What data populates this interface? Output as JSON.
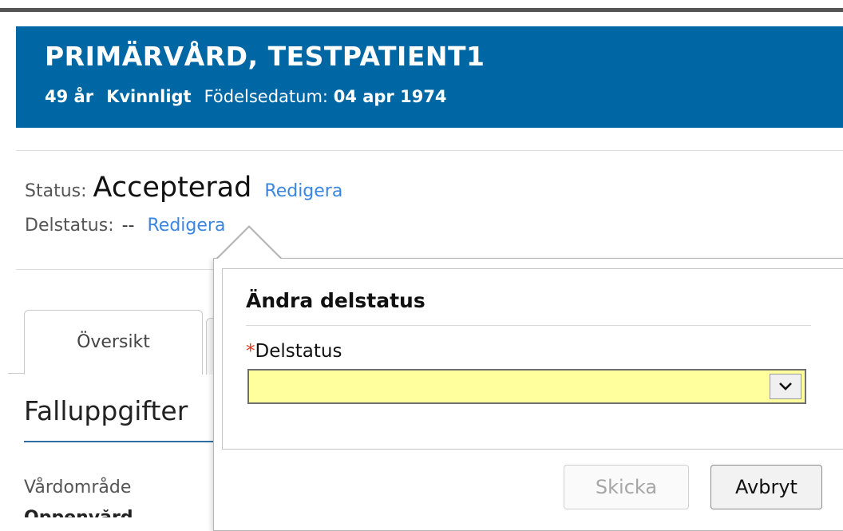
{
  "patient": {
    "name": "PRIMÄRVÅRD, TESTPATIENT1",
    "age": "49 år",
    "gender": "Kvinnligt",
    "dob_label": "Födelsedatum:",
    "dob_value": "04 apr 1974"
  },
  "status": {
    "label": "Status:",
    "value": "Accepterad",
    "edit_label": "Redigera"
  },
  "delstatus": {
    "label": "Delstatus:",
    "value": "--",
    "edit_label": "Redigera"
  },
  "tabs": [
    {
      "label": "Översikt",
      "active": true
    }
  ],
  "section": {
    "title": "Falluppgifter",
    "field_label": "Vårdområde",
    "field_value": "Öppenvård"
  },
  "popover": {
    "title": "Ändra delstatus",
    "required_marker": "*",
    "field_label": "Delstatus",
    "select_value": "",
    "send_label": "Skicka",
    "cancel_label": "Avbryt"
  },
  "colors": {
    "header_bg": "#0067a5",
    "link": "#3a86e0",
    "select_bg": "#ffff9e",
    "required": "#e0341e"
  },
  "icons": {
    "select_arrow": "chevron-down-icon"
  }
}
